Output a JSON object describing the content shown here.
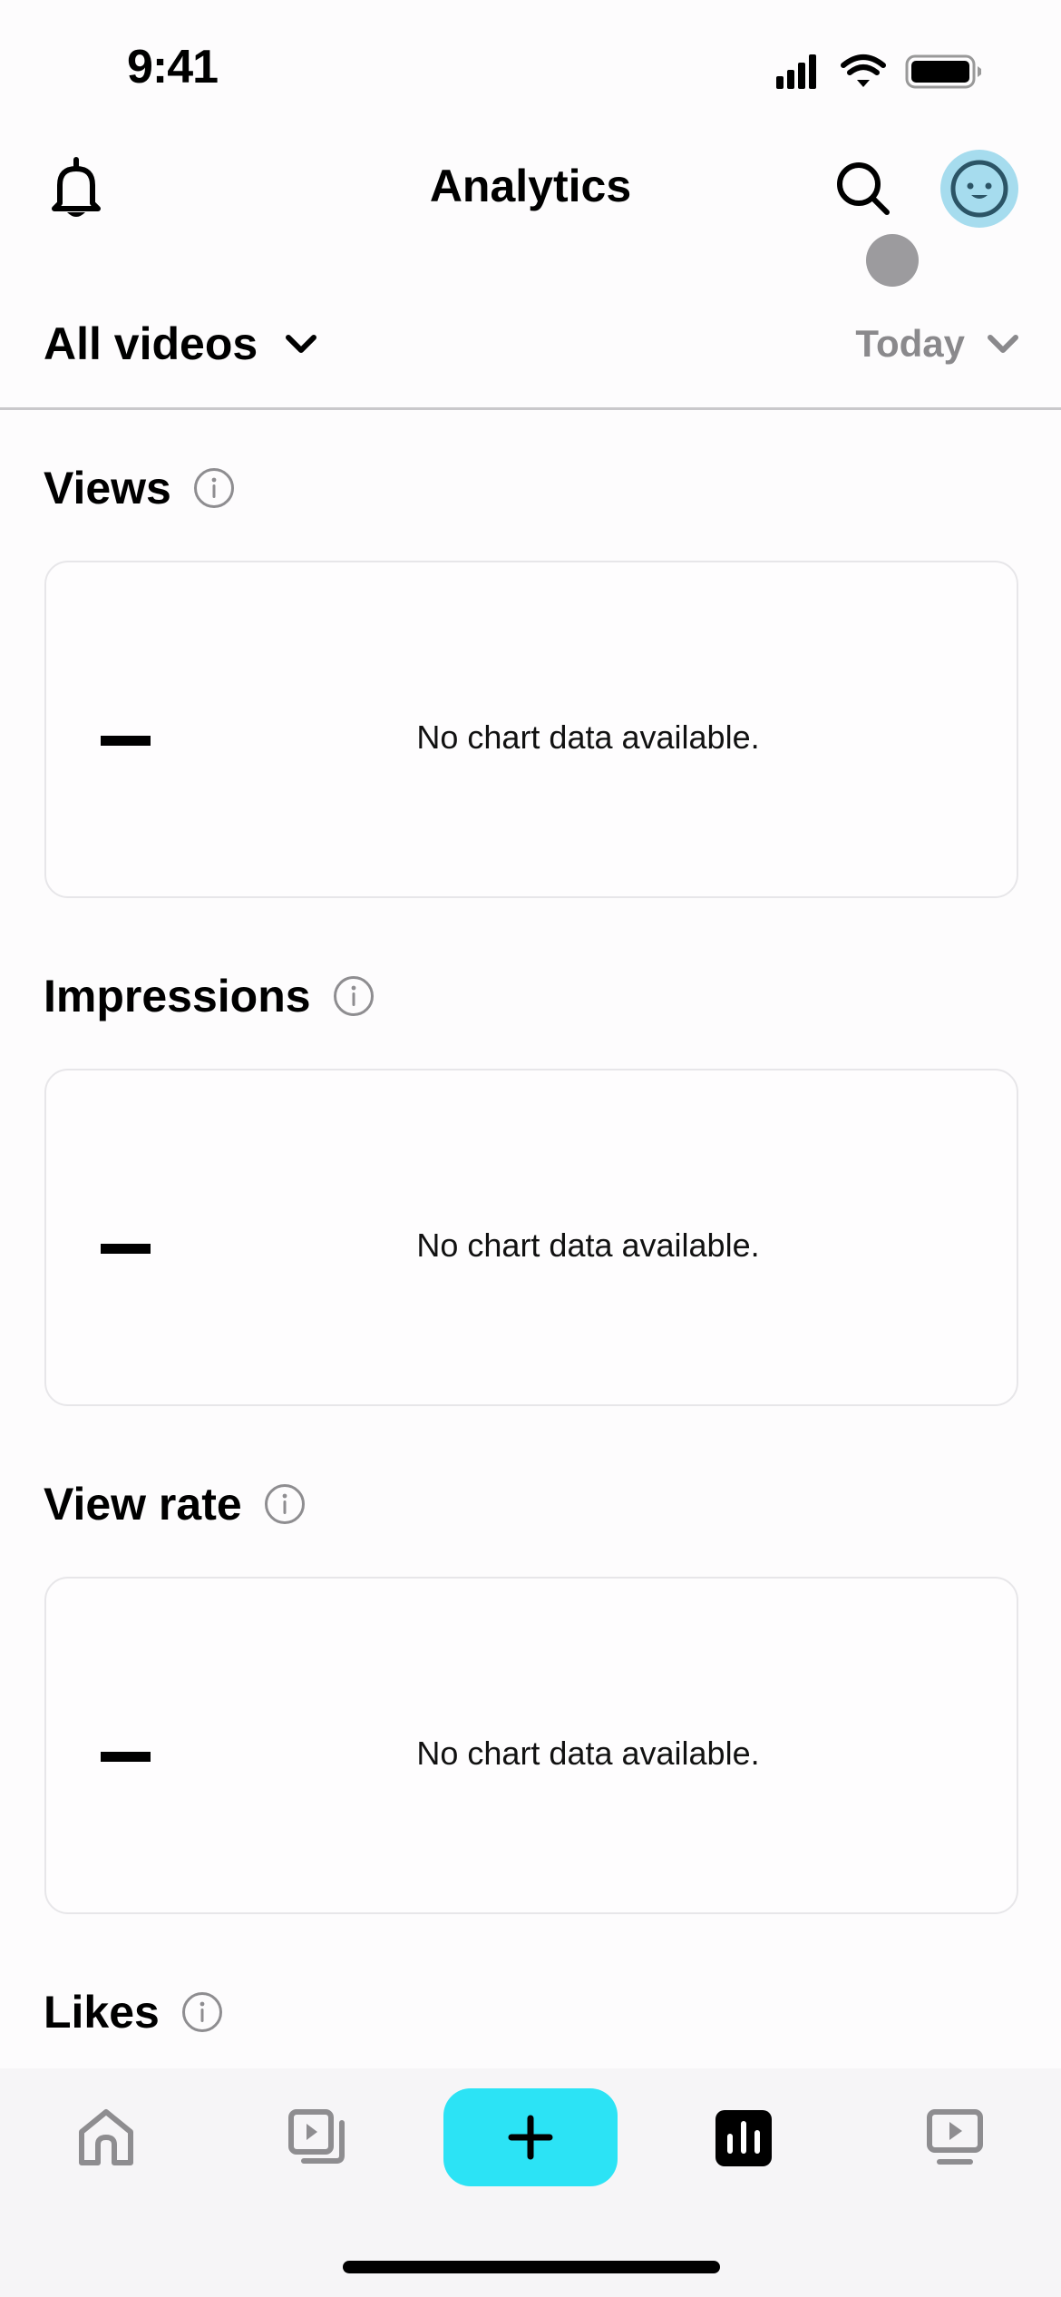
{
  "status_bar": {
    "time": "9:41",
    "icons": [
      "cellular-signal-icon",
      "wifi-icon",
      "battery-icon"
    ]
  },
  "header": {
    "title": "Analytics",
    "left_icon": "bell-icon",
    "right_icons": [
      "search-icon",
      "avatar-smiley-icon"
    ],
    "avatar_color": "#a6dcee"
  },
  "filters": {
    "video_filter": "All videos",
    "date_filter": "Today"
  },
  "sections": [
    {
      "title": "Views",
      "value": "–",
      "empty_message": "No chart data available."
    },
    {
      "title": "Impressions",
      "value": "–",
      "empty_message": "No chart data available."
    },
    {
      "title": "View rate",
      "value": "–",
      "empty_message": "No chart data available."
    },
    {
      "title": "Likes"
    }
  ],
  "bottom_nav": {
    "items": [
      {
        "name": "home",
        "icon": "home-icon",
        "active": false
      },
      {
        "name": "library",
        "icon": "video-stack-icon",
        "active": false
      },
      {
        "name": "create",
        "icon": "plus-icon",
        "active": false
      },
      {
        "name": "analytics",
        "icon": "bar-chart-icon",
        "active": true
      },
      {
        "name": "watch",
        "icon": "tv-play-icon",
        "active": false
      }
    ],
    "accent_color": "#2ce3f5"
  }
}
